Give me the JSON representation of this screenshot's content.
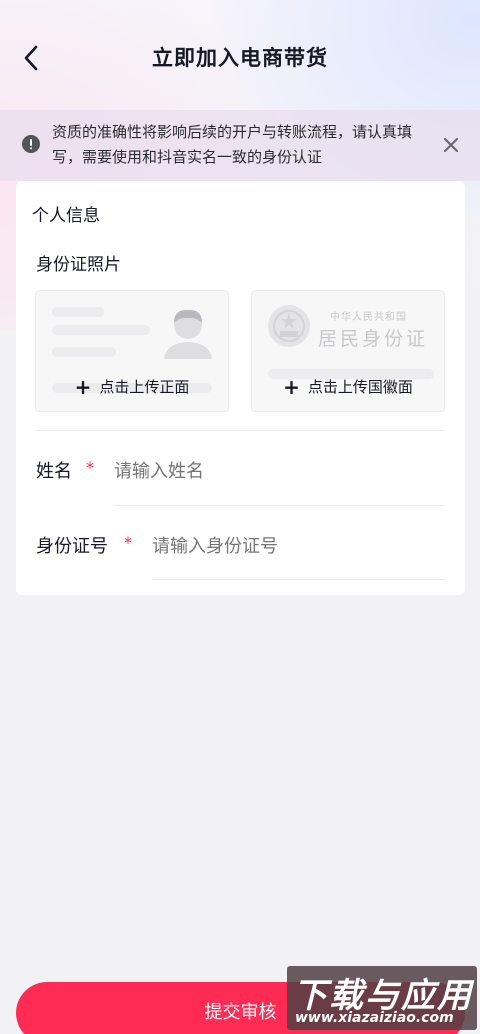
{
  "header": {
    "title": "立即加入电商带货",
    "back_icon": "chevron-left-icon"
  },
  "notice": {
    "text": "资质的准确性将影响后续的开户与转账流程，请认真填写，需要使用和抖音实名一致的身份认证",
    "info_icon": "exclamation-icon",
    "close_icon": "close-icon"
  },
  "personal_info": {
    "title": "个人信息",
    "id_photo_title": "身份证照片",
    "upload_front_label": "点击上传正面",
    "upload_back_label": "点击上传国徽面",
    "id_back_sample_small": "中华人民共和国",
    "id_back_sample_big": "居民身份证"
  },
  "fields": {
    "name_label": "姓名",
    "name_required": "*",
    "name_placeholder": "请输入姓名",
    "name_value": "",
    "id_label": "身份证号",
    "id_required": "*",
    "id_placeholder": "请输入身份证号",
    "id_value": ""
  },
  "footer": {
    "submit_label": "提交审核"
  },
  "watermark": {
    "title": "下载与应用",
    "url": "www.xiazaiziao.com"
  },
  "colors": {
    "accent": "#fe2c55",
    "text": "#161823",
    "placeholder": "#b8b8bc"
  }
}
